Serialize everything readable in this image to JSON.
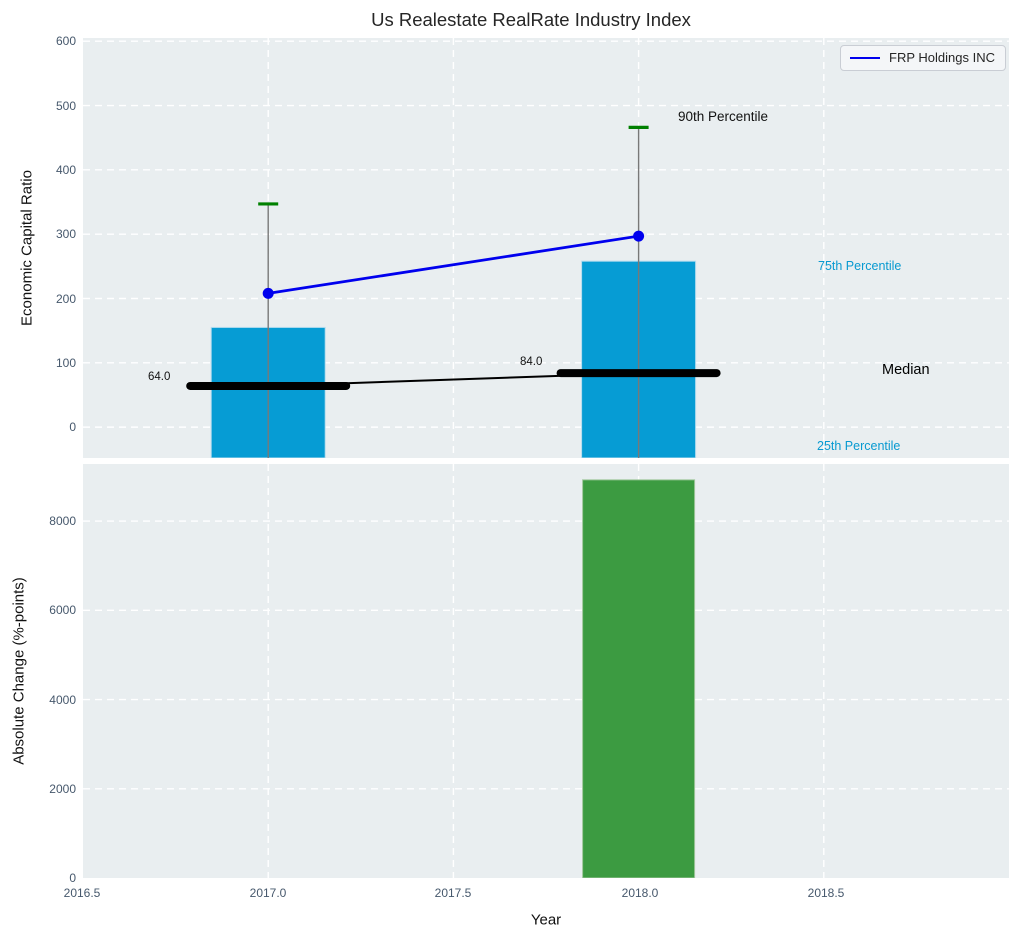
{
  "title": "Us Realestate RealRate Industry Index",
  "legend": {
    "label": "FRP Holdings INC"
  },
  "annotations": {
    "p90": "90th Percentile",
    "p75": "75th Percentile",
    "median": "Median",
    "p25": "25th Percentile",
    "median_2017": "64.0",
    "median_2018": "84.0"
  },
  "axes": {
    "top": {
      "ylabel": "Economic Capital Ratio",
      "yticks": [
        "600",
        "500",
        "400",
        "300",
        "200",
        "100",
        "0"
      ]
    },
    "bottom": {
      "ylabel": "Absolute Change (%-points)",
      "yticks": [
        "8000",
        "6000",
        "4000",
        "2000",
        "0"
      ],
      "xlabel": "Year",
      "xticks": [
        "2016.5",
        "2017.0",
        "2017.5",
        "2018.0",
        "2018.5"
      ]
    }
  },
  "colors": {
    "bar_blue": "#069cd4",
    "bar_blue_edge": "#b5dcee",
    "bar_green": "#3c9b41",
    "bar_green_edge": "#9fc79b",
    "line_blue": "#0000ee",
    "median_black": "#000000",
    "whisker_gray": "#787878",
    "whisker_cap_green": "#008000",
    "percentile_text": "#089ad1",
    "axes_background": "#e9eef0",
    "grid_white": "#ffffff",
    "tick_text": "#46586c"
  },
  "chart_data": [
    {
      "type": "bar",
      "subplot": "top",
      "title": "Us Realestate RealRate Industry Index",
      "xlabel": "Year",
      "ylabel": "Economic Capital Ratio",
      "xlim": [
        2016.5,
        2019.0
      ],
      "ylim": [
        -48,
        605
      ],
      "grid": true,
      "legend_position": "upper right",
      "x": [
        2017.0,
        2018.0
      ],
      "series": [
        {
          "name": "75th Percentile (bar top)",
          "draw": "bars",
          "color": "#069cd4",
          "edge": "#b5dcee",
          "values": [
            155,
            258
          ]
        },
        {
          "name": "90th Percentile (whisker cap)",
          "draw": "whiskers",
          "color": "#008000",
          "line_color": "#787878",
          "values": [
            347,
            466
          ]
        },
        {
          "name": "Median",
          "draw": "median",
          "color": "#000000",
          "values": [
            64.0,
            84.0
          ],
          "labels": [
            "64.0",
            "84.0"
          ]
        },
        {
          "name": "FRP Holdings INC",
          "draw": "markerline",
          "color": "#0000ee",
          "values": [
            208,
            297
          ]
        }
      ],
      "annotations": [
        "90th Percentile",
        "75th Percentile",
        "Median",
        "25th Percentile"
      ],
      "ygrid": [
        0,
        100,
        200,
        300,
        400,
        500,
        600
      ],
      "xgrid": [
        2017.0,
        2017.5,
        2018.0,
        2018.5
      ]
    },
    {
      "type": "bar",
      "subplot": "bottom",
      "xlabel": "Year",
      "ylabel": "Absolute Change (%-points)",
      "xlim": [
        2016.5,
        2019.0
      ],
      "ylim": [
        0,
        9280
      ],
      "grid": true,
      "x": [
        2018.0
      ],
      "values": [
        8925
      ],
      "color": "#3c9b41",
      "edge": "#9fc79b",
      "ygrid": [
        2000,
        4000,
        6000,
        8000
      ],
      "xgrid": [
        2017.0,
        2017.5,
        2018.0,
        2018.5
      ]
    }
  ]
}
